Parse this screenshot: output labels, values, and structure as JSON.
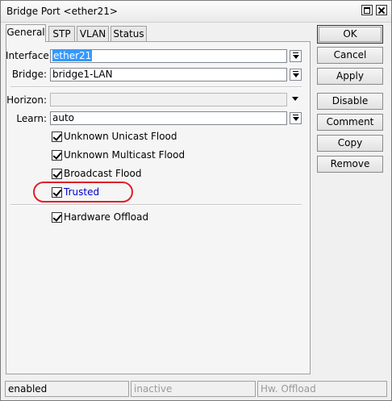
{
  "window": {
    "title": "Bridge Port <ether21>"
  },
  "tabs": [
    {
      "label": "General",
      "active": true
    },
    {
      "label": "STP",
      "active": false
    },
    {
      "label": "VLAN",
      "active": false
    },
    {
      "label": "Status",
      "active": false
    }
  ],
  "form": {
    "interface": {
      "label": "Interface:",
      "value": "ether21"
    },
    "bridge": {
      "label": "Bridge:",
      "value": "bridge1-LAN"
    },
    "horizon": {
      "label": "Horizon:",
      "value": ""
    },
    "learn": {
      "label": "Learn:",
      "value": "auto"
    }
  },
  "checkboxes": [
    {
      "label": "Unknown Unicast Flood",
      "checked": true
    },
    {
      "label": "Unknown Multicast Flood",
      "checked": true
    },
    {
      "label": "Broadcast Flood",
      "checked": true
    },
    {
      "label": "Trusted",
      "checked": true
    },
    {
      "label": "Hardware Offload",
      "checked": true
    }
  ],
  "buttons": {
    "ok": "OK",
    "cancel": "Cancel",
    "apply": "Apply",
    "disable": "Disable",
    "comment": "Comment",
    "copy": "Copy",
    "remove": "Remove"
  },
  "status_bar": {
    "state": "enabled",
    "running": "inactive",
    "hw_offload": "Hw. Offload"
  },
  "colors": {
    "highlight_circle": "#e0202a",
    "selected_text_bg": "#3399ff",
    "trusted_label": "#0000cc"
  }
}
